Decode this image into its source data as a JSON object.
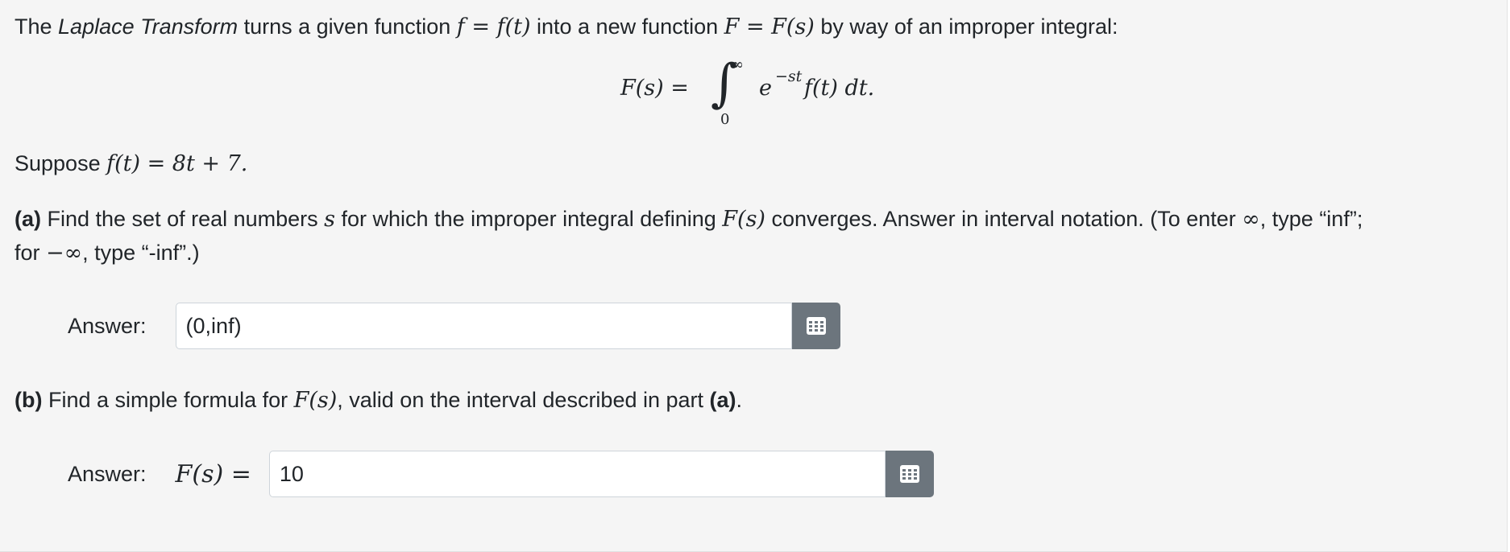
{
  "intro": {
    "text1": "The ",
    "term": "Laplace Transform",
    "text2": " turns a given function ",
    "math1": "f = f(t)",
    "text3": " into a new function ",
    "math2": "F = F(s)",
    "text4": " by way of an improper integral:"
  },
  "formula": {
    "lhs": "F(s) =",
    "integral": "∫",
    "upper": "∞",
    "lower": "0",
    "integrand": "e",
    "exponent": "−st",
    "rest": "f(t) dt."
  },
  "suppose": {
    "text": "Suppose ",
    "math": "f(t) = 8t + 7."
  },
  "part_a": {
    "label": "(a)",
    "text1": " Find the set of real numbers ",
    "var": "s",
    "text2": " for which the improper integral defining ",
    "math": "F(s)",
    "text3": " converges. Answer in interval notation. (To enter ",
    "inf": "∞",
    "text4": ", type “inf”;",
    "line2_text1": "for ",
    "neg_inf": "−∞",
    "line2_text2": ", type “-inf”.)",
    "answer_label": "Answer:",
    "answer_value": "(0,inf)",
    "button_icon": "grid-icon"
  },
  "part_b": {
    "label": "(b)",
    "text1": " Find a simple formula for ",
    "math": "F(s)",
    "text2": ", valid on the interval described in part ",
    "ref": "(a)",
    "text3": ".",
    "answer_label": "Answer:",
    "answer_prefix": "F(s) =",
    "answer_value": "10",
    "button_icon": "grid-icon"
  },
  "colors": {
    "background": "#f5f5f5",
    "button": "#6c757d",
    "input_border": "#ced4da"
  }
}
